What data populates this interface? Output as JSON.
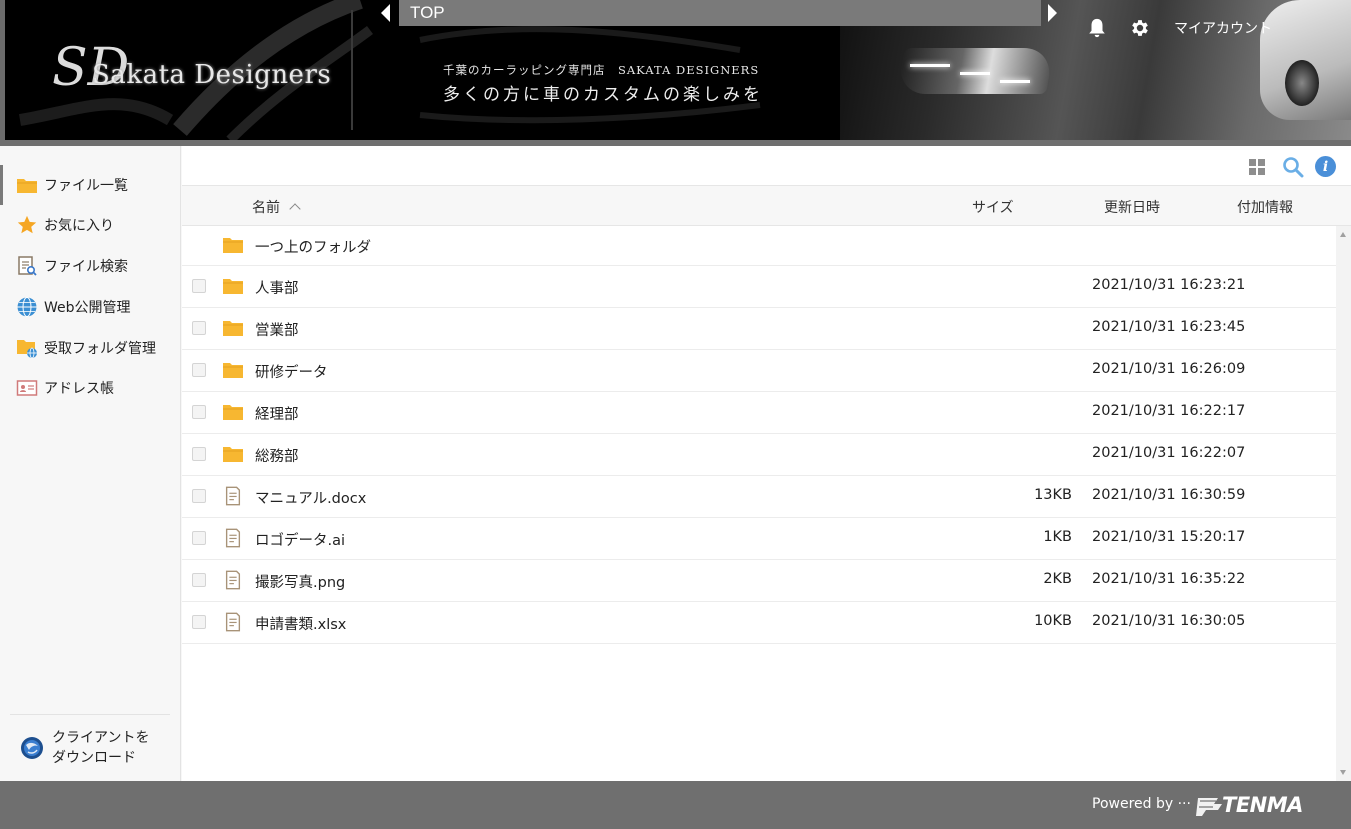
{
  "header": {
    "logo_text": "Sakata Designers",
    "logo_mark": "SD",
    "tagline_small": "千葉のカーラッピング専門店　SAKATA DESIGNERS",
    "tagline_large": "多くの方に車のカスタムの楽しみを",
    "breadcrumb": "TOP",
    "account_label": "マイアカウント",
    "icons": {
      "notifications": "bell-icon",
      "settings": "gear-icon"
    }
  },
  "sidebar": {
    "items": [
      {
        "label": "ファイル一覧",
        "icon": "folder-icon",
        "active": true
      },
      {
        "label": "お気に入り",
        "icon": "star-icon",
        "active": false
      },
      {
        "label": "ファイル検索",
        "icon": "file-search-icon",
        "active": false
      },
      {
        "label": "Web公開管理",
        "icon": "globe-icon",
        "active": false
      },
      {
        "label": "受取フォルダ管理",
        "icon": "folder-globe-icon",
        "active": false
      },
      {
        "label": "アドレス帳",
        "icon": "address-card-icon",
        "active": false
      }
    ],
    "client_download_label": "クライアントを ダウンロード"
  },
  "toolbar": {
    "icons": [
      "grid-view-icon",
      "search-icon",
      "info-icon"
    ],
    "info_glyph": "i"
  },
  "columns": {
    "name": "名前",
    "size": "サイズ",
    "updated": "更新日時",
    "extra": "付加情報"
  },
  "files": [
    {
      "name": "一つ上のフォルダ",
      "type": "folder",
      "size": "",
      "date": "",
      "checkbox": false
    },
    {
      "name": "人事部",
      "type": "folder",
      "size": "",
      "date": "2021/10/31 16:23:21",
      "checkbox": true
    },
    {
      "name": "営業部",
      "type": "folder",
      "size": "",
      "date": "2021/10/31 16:23:45",
      "checkbox": true
    },
    {
      "name": "研修データ",
      "type": "folder",
      "size": "",
      "date": "2021/10/31 16:26:09",
      "checkbox": true
    },
    {
      "name": "経理部",
      "type": "folder",
      "size": "",
      "date": "2021/10/31 16:22:17",
      "checkbox": true
    },
    {
      "name": "総務部",
      "type": "folder",
      "size": "",
      "date": "2021/10/31 16:22:07",
      "checkbox": true
    },
    {
      "name": "マニュアル.docx",
      "type": "file",
      "size": "13KB",
      "date": "2021/10/31 16:30:59",
      "checkbox": true
    },
    {
      "name": "ロゴデータ.ai",
      "type": "file",
      "size": "1KB",
      "date": "2021/10/31 15:20:17",
      "checkbox": true
    },
    {
      "name": "撮影写真.png",
      "type": "file",
      "size": "2KB",
      "date": "2021/10/31 16:35:22",
      "checkbox": true
    },
    {
      "name": "申請書類.xlsx",
      "type": "file",
      "size": "10KB",
      "date": "2021/10/31 16:30:05",
      "checkbox": true
    }
  ],
  "footer": {
    "powered_by": "Powered by ···",
    "brand": "TENMA"
  },
  "colors": {
    "header_bg": "#000000",
    "gray_band": "#6f6f6f",
    "folder": "#f7b731",
    "accent_blue": "#4a8fd8",
    "star": "#f5a623"
  }
}
